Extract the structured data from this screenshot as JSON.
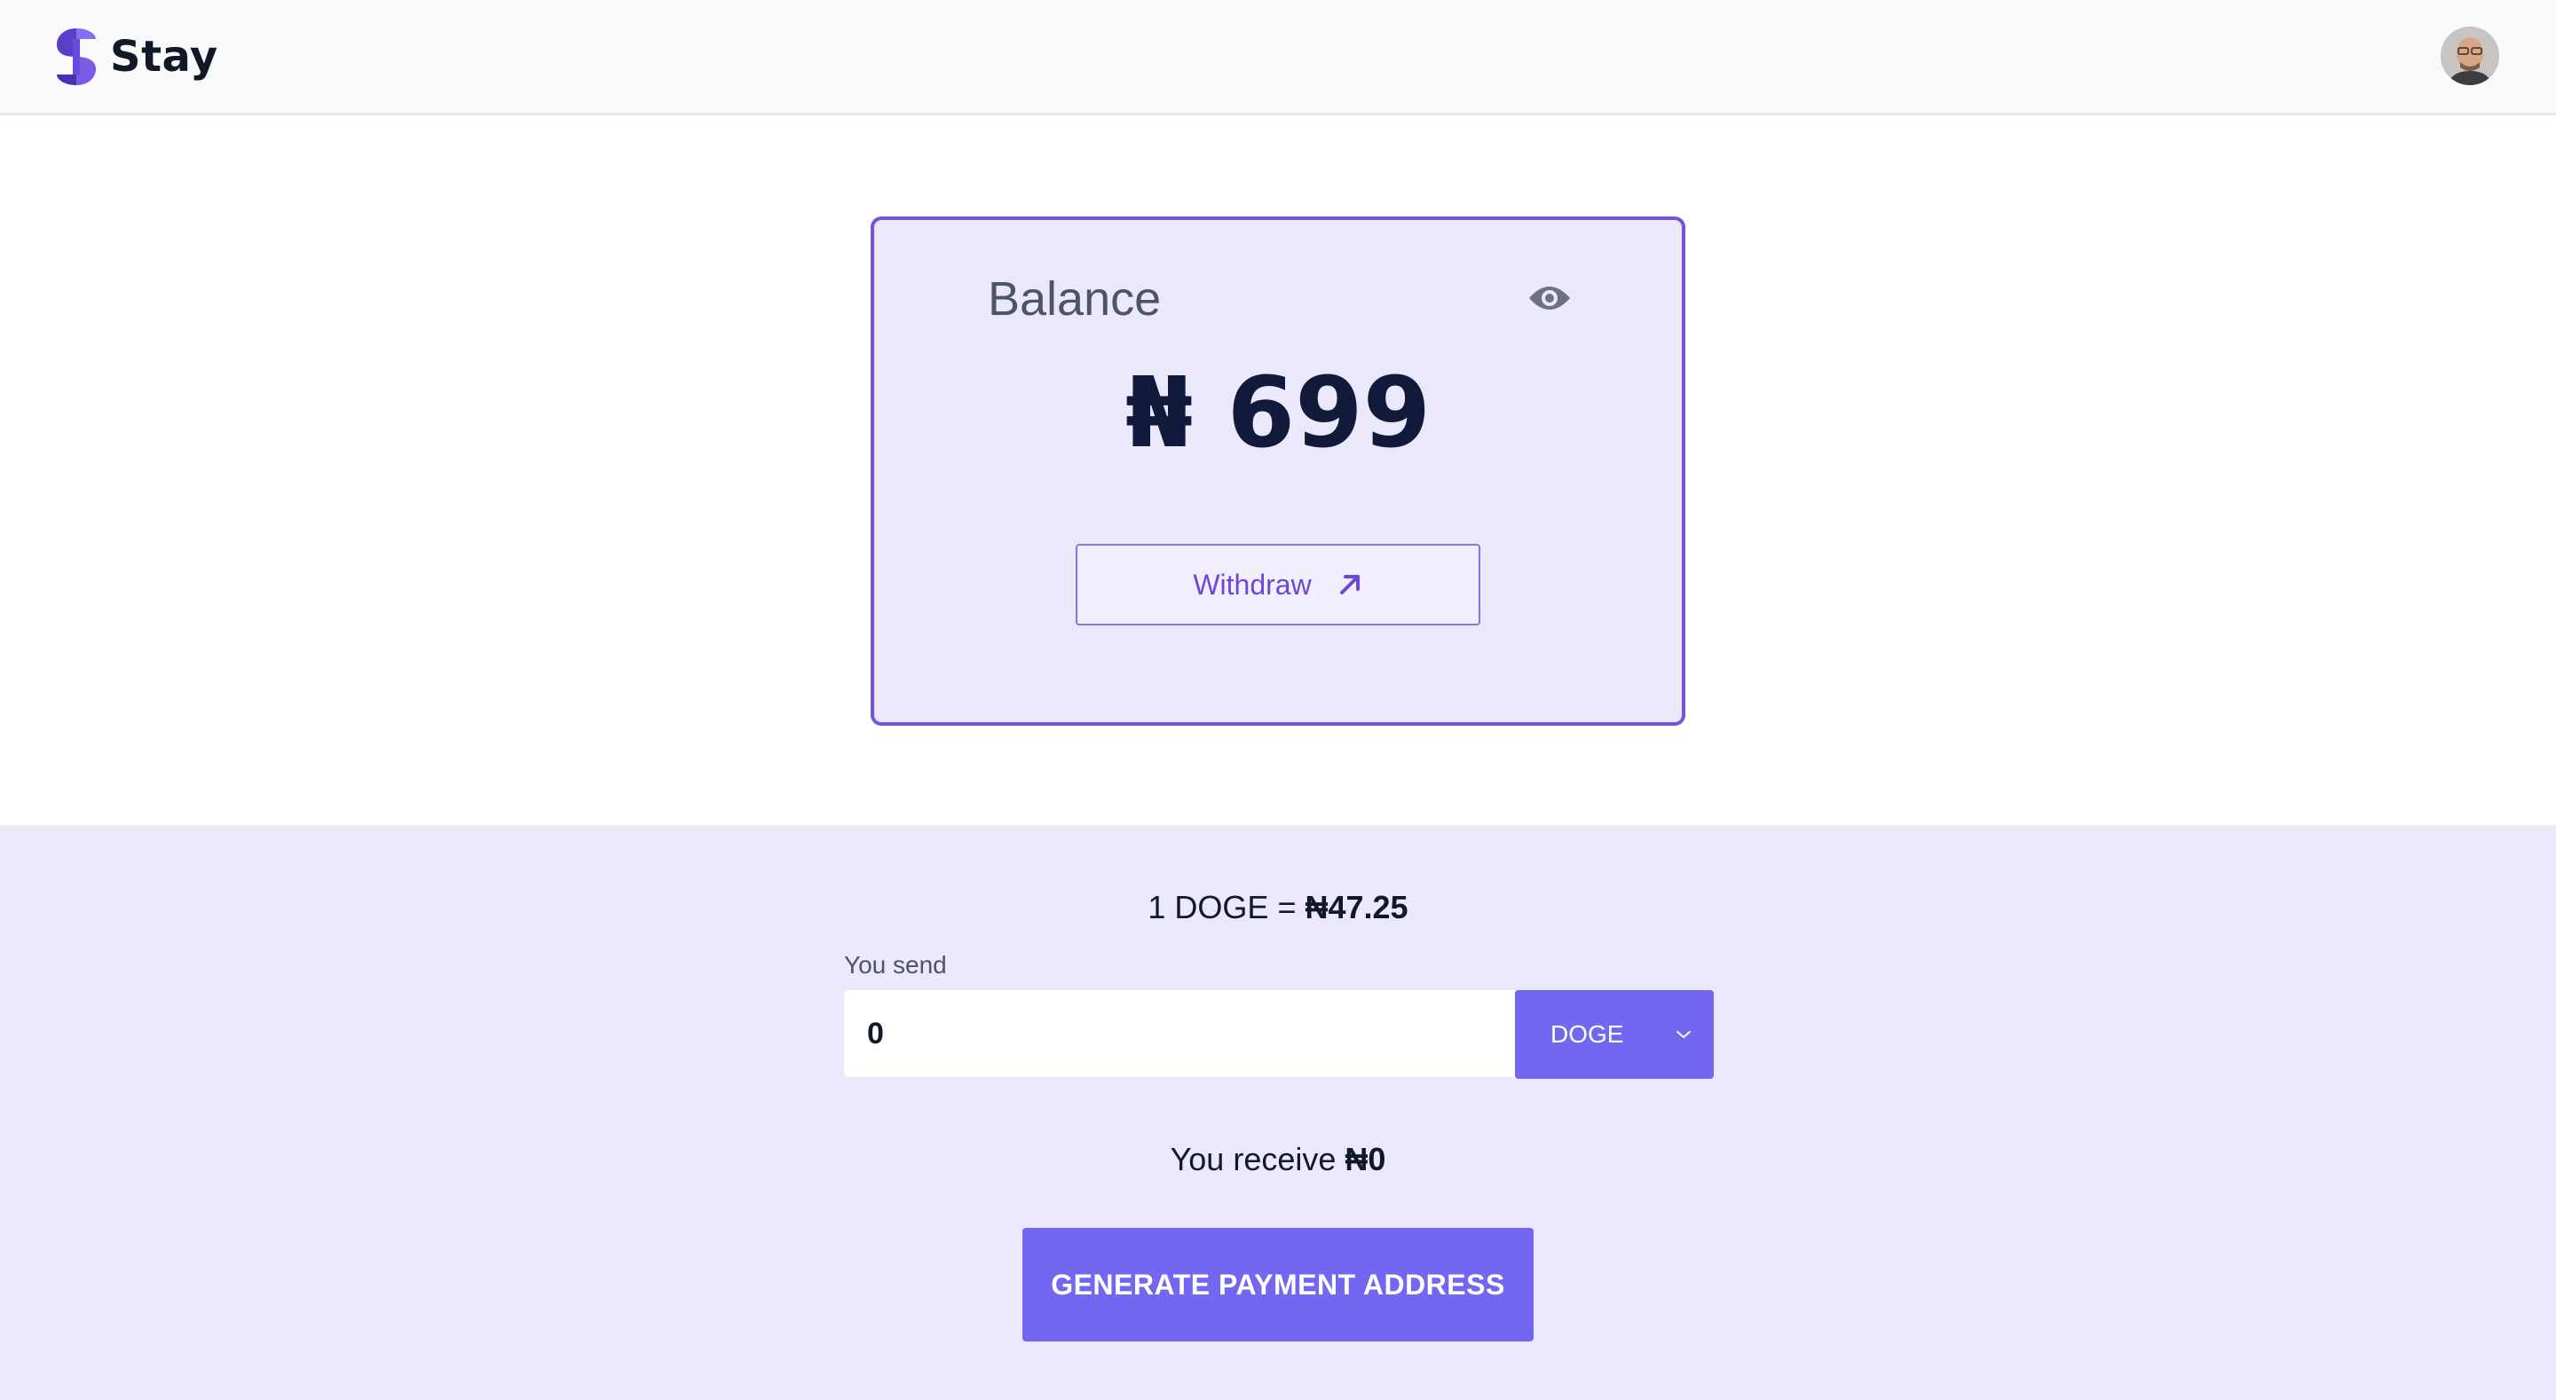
{
  "header": {
    "brand_name": "Stay",
    "logo_icon": "stay-logo",
    "avatar_icon": "user-avatar"
  },
  "balance": {
    "label": "Balance",
    "amount": "₦ 699",
    "visibility_icon": "eye-icon",
    "withdraw_label": "Withdraw",
    "withdraw_icon": "arrow-up-right-icon"
  },
  "exchange": {
    "rate_prefix": "1 DOGE = ",
    "rate_value": "₦47.25",
    "send_label": "You send",
    "send_value": "0",
    "currency_selected": "DOGE",
    "currency_icon": "chevron-down-icon",
    "receive_prefix": "You receive ",
    "receive_value": "₦0",
    "generate_label": "GENERATE PAYMENT ADDRESS"
  },
  "colors": {
    "brand_purple": "#7653db",
    "card_bg": "#ece8fc",
    "button_indigo": "#7366f1",
    "text_dark": "#111a3a"
  }
}
